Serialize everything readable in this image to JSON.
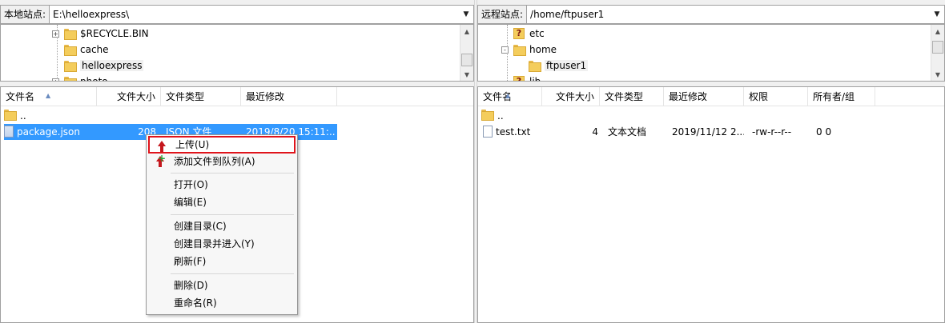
{
  "left": {
    "site_label": "本地站点:",
    "site_path": "E:\\helloexpress\\",
    "tree": [
      {
        "label": "$RECYCLE.BIN",
        "expander": "+"
      },
      {
        "label": "cache",
        "expander": ""
      },
      {
        "label": "helloexpress",
        "expander": ""
      },
      {
        "label": "photo",
        "expander": "+"
      }
    ],
    "columns": [
      "文件名",
      "文件大小",
      "文件类型",
      "最近修改"
    ],
    "rows": [
      {
        "name": "..",
        "size": "",
        "type": "",
        "modified": ""
      },
      {
        "name": "package.json",
        "size": "208",
        "type": "JSON 文件",
        "modified": "2019/8/20 15:11:..."
      }
    ]
  },
  "right": {
    "site_label": "远程站点:",
    "site_path": "/home/ftpuser1",
    "tree": [
      {
        "label": "etc",
        "icon": "unknown"
      },
      {
        "label": "home",
        "expander": "-"
      },
      {
        "label": "ftpuser1",
        "icon": "folder"
      },
      {
        "label": "lib",
        "icon": "unknown"
      }
    ],
    "columns": [
      "文件名",
      "文件大小",
      "文件类型",
      "最近修改",
      "权限",
      "所有者/组"
    ],
    "rows": [
      {
        "name": "..",
        "size": "",
        "type": "",
        "modified": "",
        "perm": "",
        "owner": ""
      },
      {
        "name": "test.txt",
        "size": "4",
        "type": "文本文档",
        "modified": "2019/11/12 2...",
        "perm": "-rw-r--r--",
        "owner": "0 0"
      }
    ]
  },
  "context_menu": {
    "items": [
      {
        "label": "上传(U)",
        "icon": "upload-icon",
        "highlighted": true
      },
      {
        "label": "添加文件到队列(A)",
        "icon": "add-to-queue-icon"
      },
      {
        "label": "打开(O)"
      },
      {
        "label": "编辑(E)"
      },
      {
        "label": "创建目录(C)"
      },
      {
        "label": "创建目录并进入(Y)"
      },
      {
        "label": "刷新(F)"
      },
      {
        "label": "删除(D)"
      },
      {
        "label": "重命名(R)"
      }
    ]
  },
  "colors": {
    "selection": "#3399ff",
    "highlight_border": "#e0141b",
    "upload_arrow": "#c5171d"
  }
}
